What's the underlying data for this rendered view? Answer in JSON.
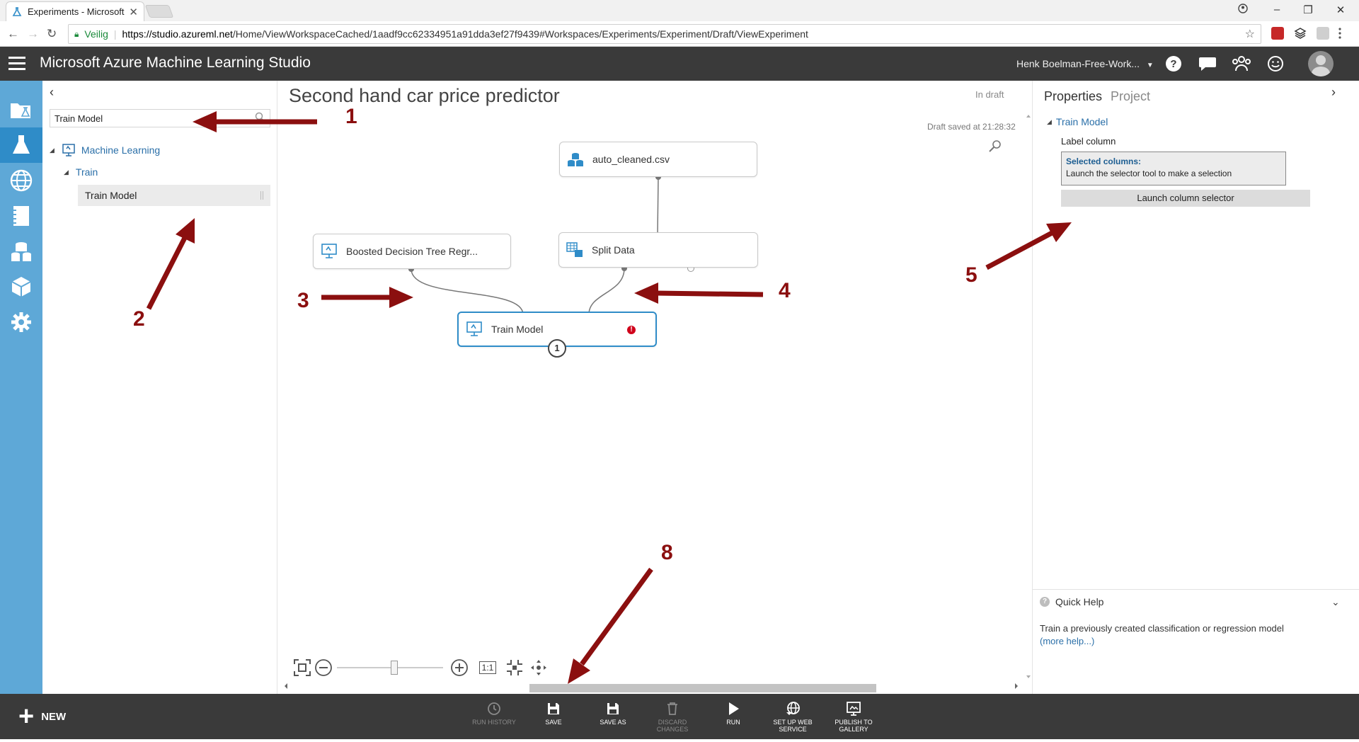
{
  "browser": {
    "tab_title": "Experiments - Microsoft",
    "secure_label": "Veilig",
    "url_host": "https://studio.azureml.net",
    "url_path": "/Home/ViewWorkspaceCached/1aadf9cc62334951a91dda3ef27f9439#Workspaces/Experiments/Experiment/Draft/ViewExperiment"
  },
  "app": {
    "title": "Microsoft Azure Machine Learning Studio",
    "workspace": "Henk Boelman-Free-Work...",
    "accent": "#2f8cc8"
  },
  "palette": {
    "search_value": "Train Model",
    "tree": {
      "category": "Machine Learning",
      "subcategory": "Train",
      "leaf": "Train Model"
    }
  },
  "canvas": {
    "experiment_title": "Second hand car price predictor",
    "status": "In draft",
    "saved": "Draft saved at 21:28:32",
    "modules": {
      "dataset": "auto_cleaned.csv",
      "split": "Split Data",
      "boosted": "Boosted Decision Tree Regr...",
      "train": "Train Model",
      "train_badge": "1",
      "train_error": "!"
    },
    "zoom_actual": "1:1"
  },
  "properties": {
    "tab_properties": "Properties",
    "tab_project": "Project",
    "section": "Train Model",
    "label_column": "Label column",
    "selected_title": "Selected columns:",
    "selected_hint": "Launch the selector tool to make a selection",
    "launch_button": "Launch column selector",
    "quick_help_title": "Quick Help",
    "quick_help_text": "Train a previously created classification or regression model",
    "quick_help_link": "(more help...)"
  },
  "bottom": {
    "new_label": "NEW",
    "commands": {
      "run_history": "RUN HISTORY",
      "save": "SAVE",
      "save_as": "SAVE AS",
      "discard": "DISCARD CHANGES",
      "run": "RUN",
      "setup_ws_1": "SET UP WEB",
      "setup_ws_2": "SERVICE",
      "publish_1": "PUBLISH TO",
      "publish_2": "GALLERY"
    }
  },
  "annotations": {
    "n1": "1",
    "n2": "2",
    "n3": "3",
    "n4": "4",
    "n5": "5",
    "n8": "8",
    "color": "#8b0f0f"
  }
}
